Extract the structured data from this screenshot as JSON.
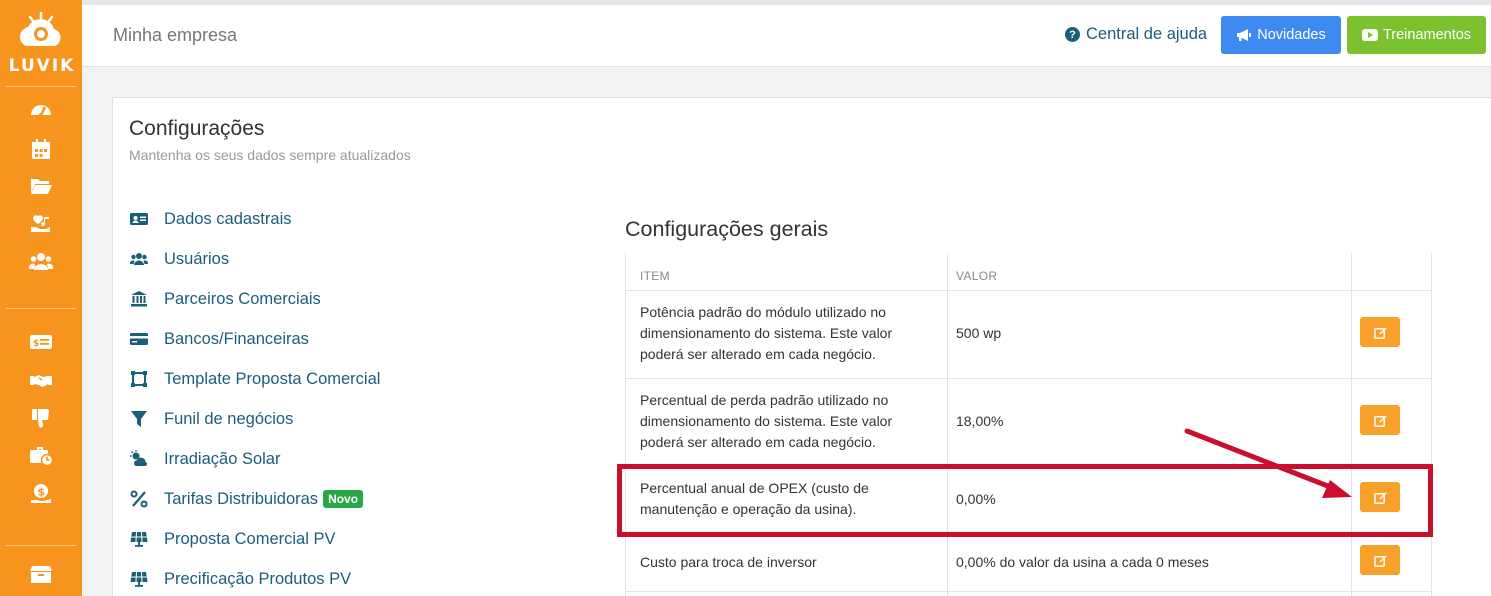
{
  "sidebar": {
    "logo_text": "LUVIK",
    "icons": [
      "dashboard-icon",
      "calendar-icon",
      "folder-open-icon",
      "hand-holding-icon",
      "users-icon",
      "money-bill-icon",
      "handshake-icon",
      "thumbs-down-icon",
      "briefcase-clock-icon",
      "hand-dollar-icon",
      "box-icon"
    ]
  },
  "header": {
    "company": "Minha empresa",
    "help_label": "Central de ajuda",
    "news_label": "Novidades",
    "training_label": "Treinamentos",
    "news_color": "#3d8bf0",
    "training_color": "#7cc22e"
  },
  "page": {
    "title": "Configurações",
    "subtitle": "Mantenha os seus dados sempre atualizados"
  },
  "menu": [
    {
      "label": "Dados cadastrais",
      "icon": "id-card-icon"
    },
    {
      "label": "Usuários",
      "icon": "users-icon"
    },
    {
      "label": "Parceiros Comerciais",
      "icon": "bank-icon"
    },
    {
      "label": "Bancos/Financeiras",
      "icon": "credit-card-icon"
    },
    {
      "label": "Template Proposta Comercial",
      "icon": "template-icon"
    },
    {
      "label": "Funil de negócios",
      "icon": "funnel-icon"
    },
    {
      "label": "Irradiação Solar",
      "icon": "sun-cloud-icon"
    },
    {
      "label": "Tarifas Distribuidoras",
      "icon": "percent-icon",
      "badge": "Novo"
    },
    {
      "label": "Proposta Comercial PV",
      "icon": "solar-panel-icon"
    },
    {
      "label": "Precificação Produtos PV",
      "icon": "solar-panel-icon"
    }
  ],
  "config": {
    "title": "Configurações gerais",
    "col_item": "ITEM",
    "col_value": "VALOR",
    "rows": [
      {
        "item": "Potência padrão do módulo utilizado no dimensionamento do sistema. Este valor poderá ser alterado em cada negócio.",
        "value": "500 wp"
      },
      {
        "item": "Percentual de perda padrão utilizado no dimensionamento do sistema. Este valor poderá ser alterado em cada negócio.",
        "value": "18,00%"
      },
      {
        "item": "Percentual anual de OPEX (custo de manutenção e operação da usina).",
        "value": "0,00%"
      },
      {
        "item": "Custo para troca de inversor",
        "value": "0,00% do valor da usina a cada 0 meses"
      }
    ]
  },
  "colors": {
    "sidebar": "#f7941d",
    "link": "#1a5f7a",
    "edit_button": "#f7a12a",
    "highlight": "#c8102e"
  }
}
